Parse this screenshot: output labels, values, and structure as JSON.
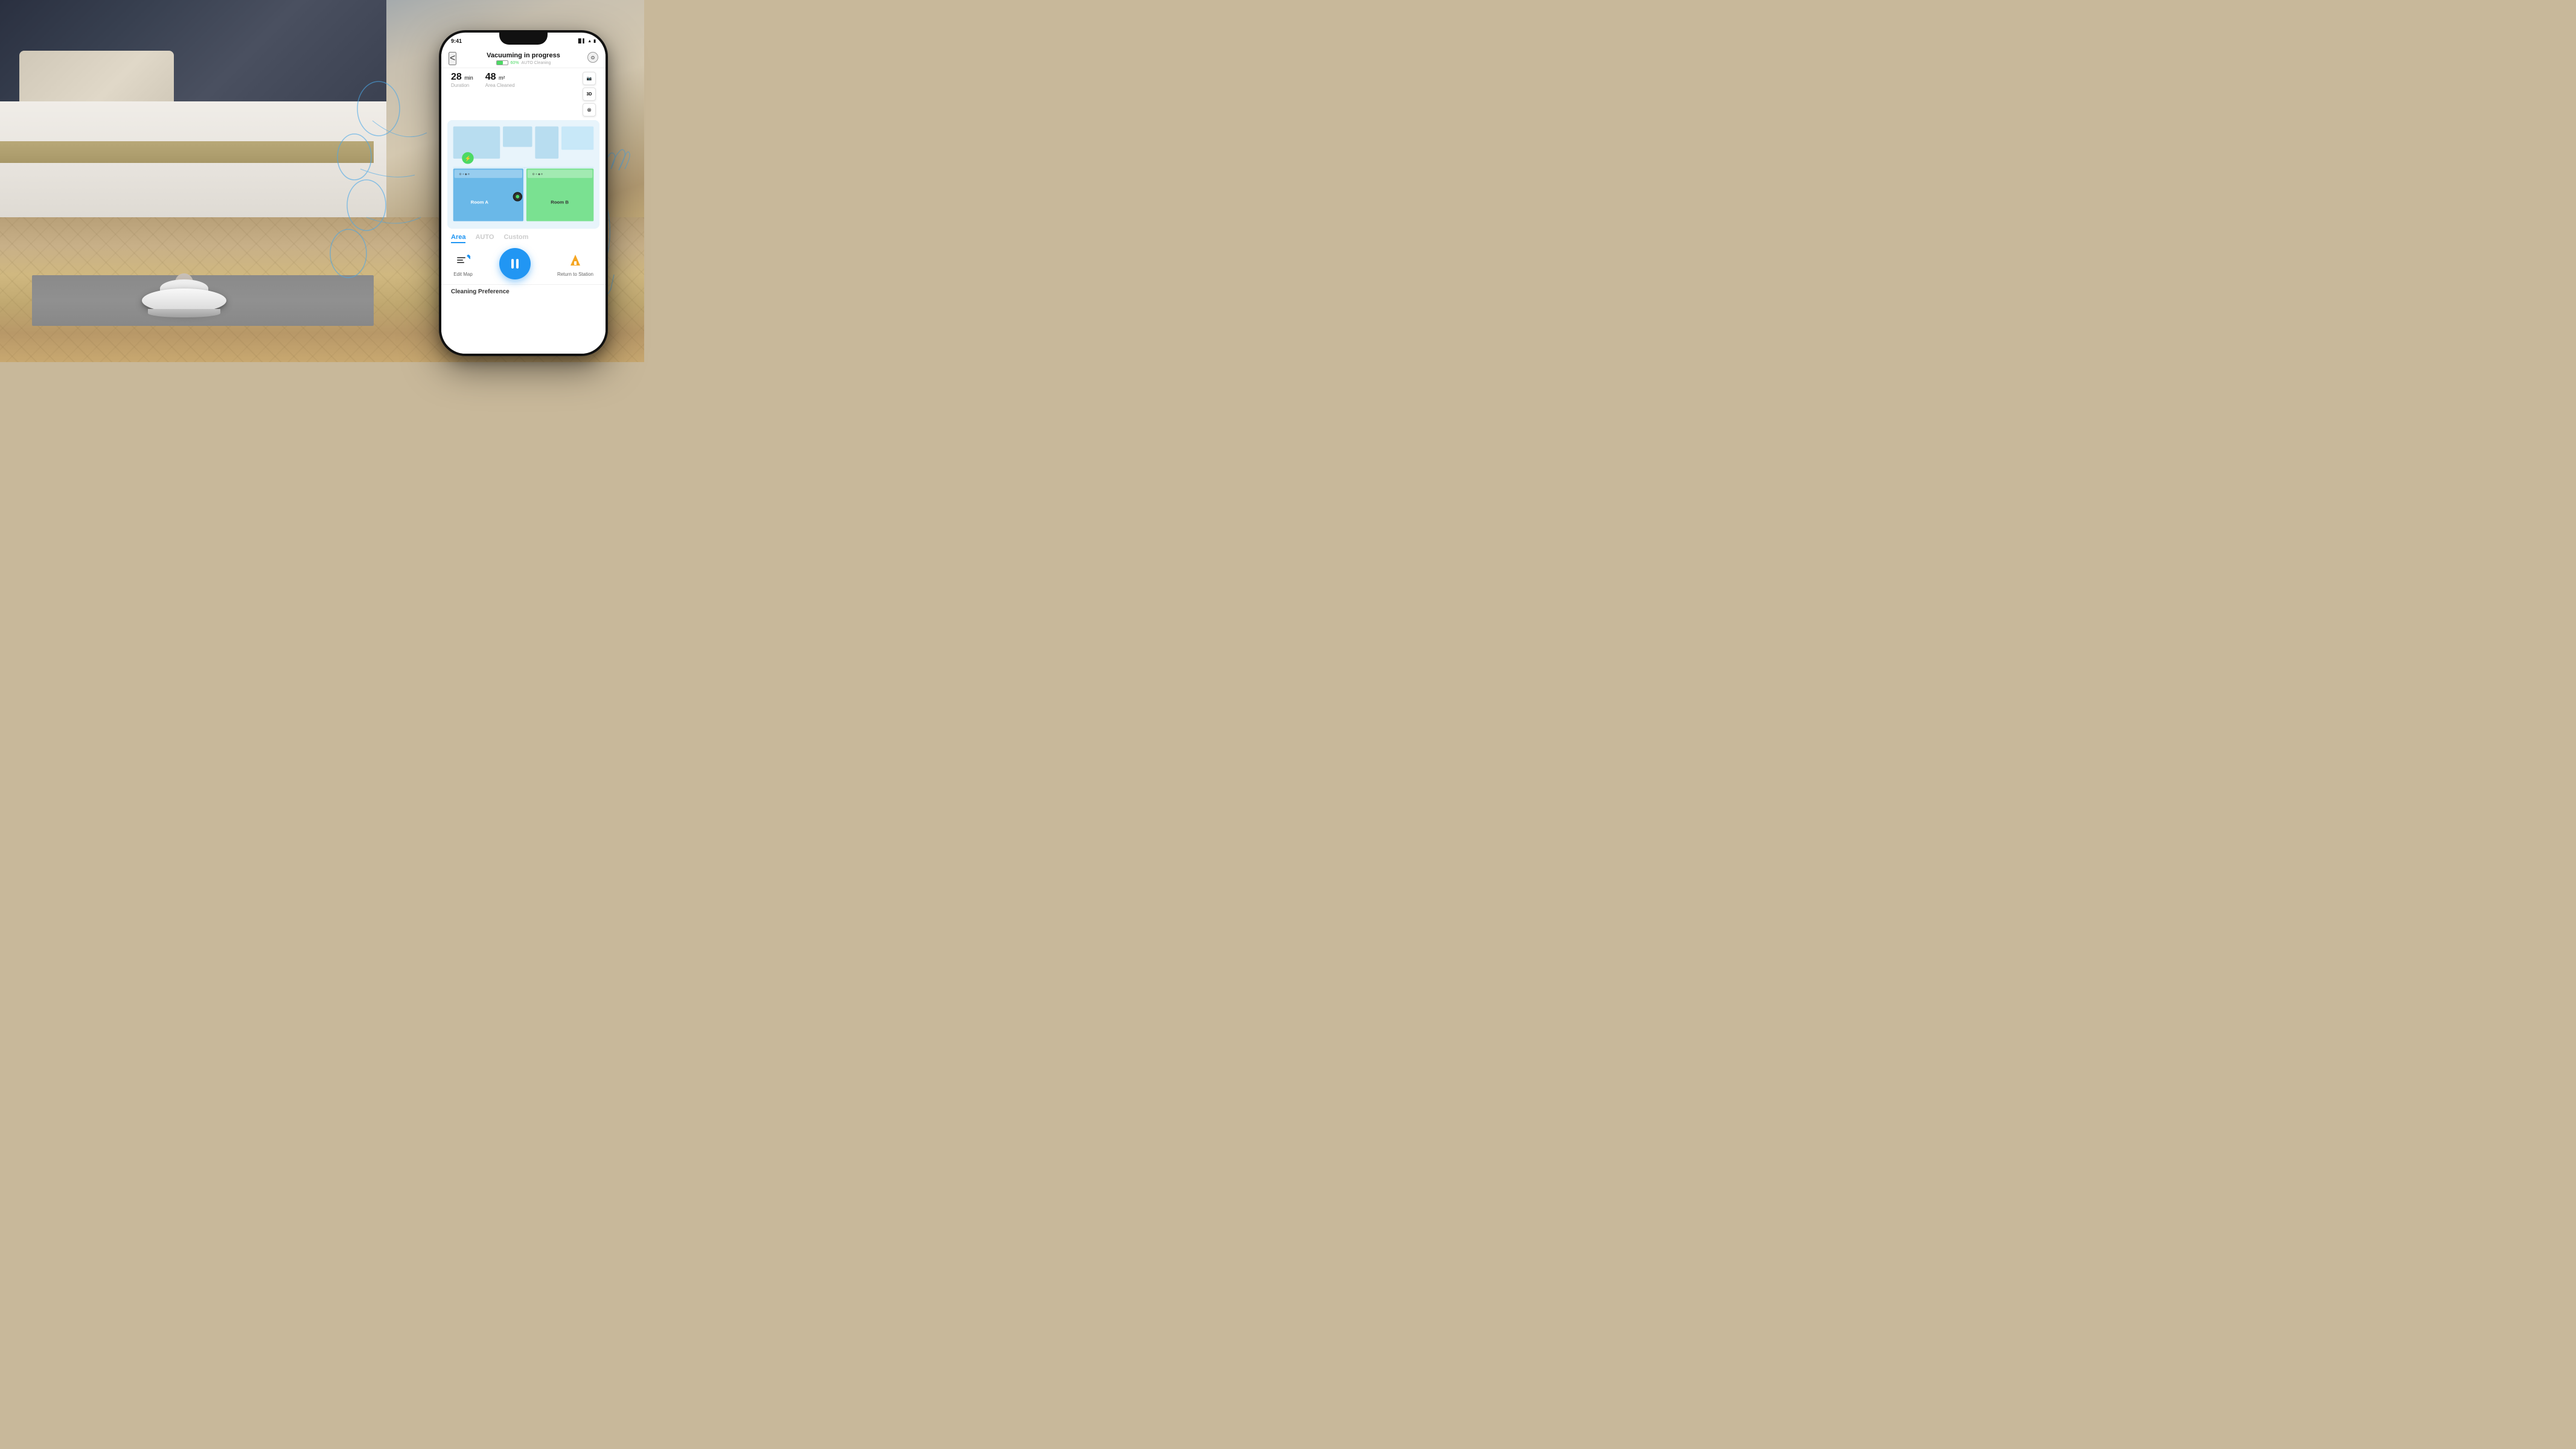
{
  "scene": {
    "background_desc": "Bedroom with robot vacuum on herringbone floor"
  },
  "status_bar": {
    "time": "9:41",
    "signal": "●●●",
    "wifi": "WiFi",
    "battery": "Battery"
  },
  "app": {
    "header": {
      "back_label": "<",
      "title": "Vacuuming in progress",
      "battery_pct": "60%",
      "cleaning_mode": "AUTO Cleaning",
      "settings_icon": "⊙"
    },
    "stats": {
      "duration_value": "28",
      "duration_unit": "min",
      "duration_label": "Duration",
      "area_value": "48",
      "area_unit": "m²",
      "area_label": "Area Cleaned"
    },
    "map": {
      "room_a_label": "Room A",
      "room_b_label": "Room B",
      "view_3d_label": "3D",
      "layers_label": "⊗"
    },
    "tabs": [
      {
        "id": "area",
        "label": "Area",
        "active": true
      },
      {
        "id": "auto",
        "label": "AUTO",
        "active": false
      },
      {
        "id": "custom",
        "label": "Custom",
        "active": false
      }
    ],
    "controls": {
      "edit_map_label": "Edit Map",
      "edit_map_icon": "✏",
      "pause_label": "pause",
      "return_label": "Return to Station",
      "return_icon": "⚡"
    },
    "cleaning_preference_label": "Cleaning Preference"
  }
}
